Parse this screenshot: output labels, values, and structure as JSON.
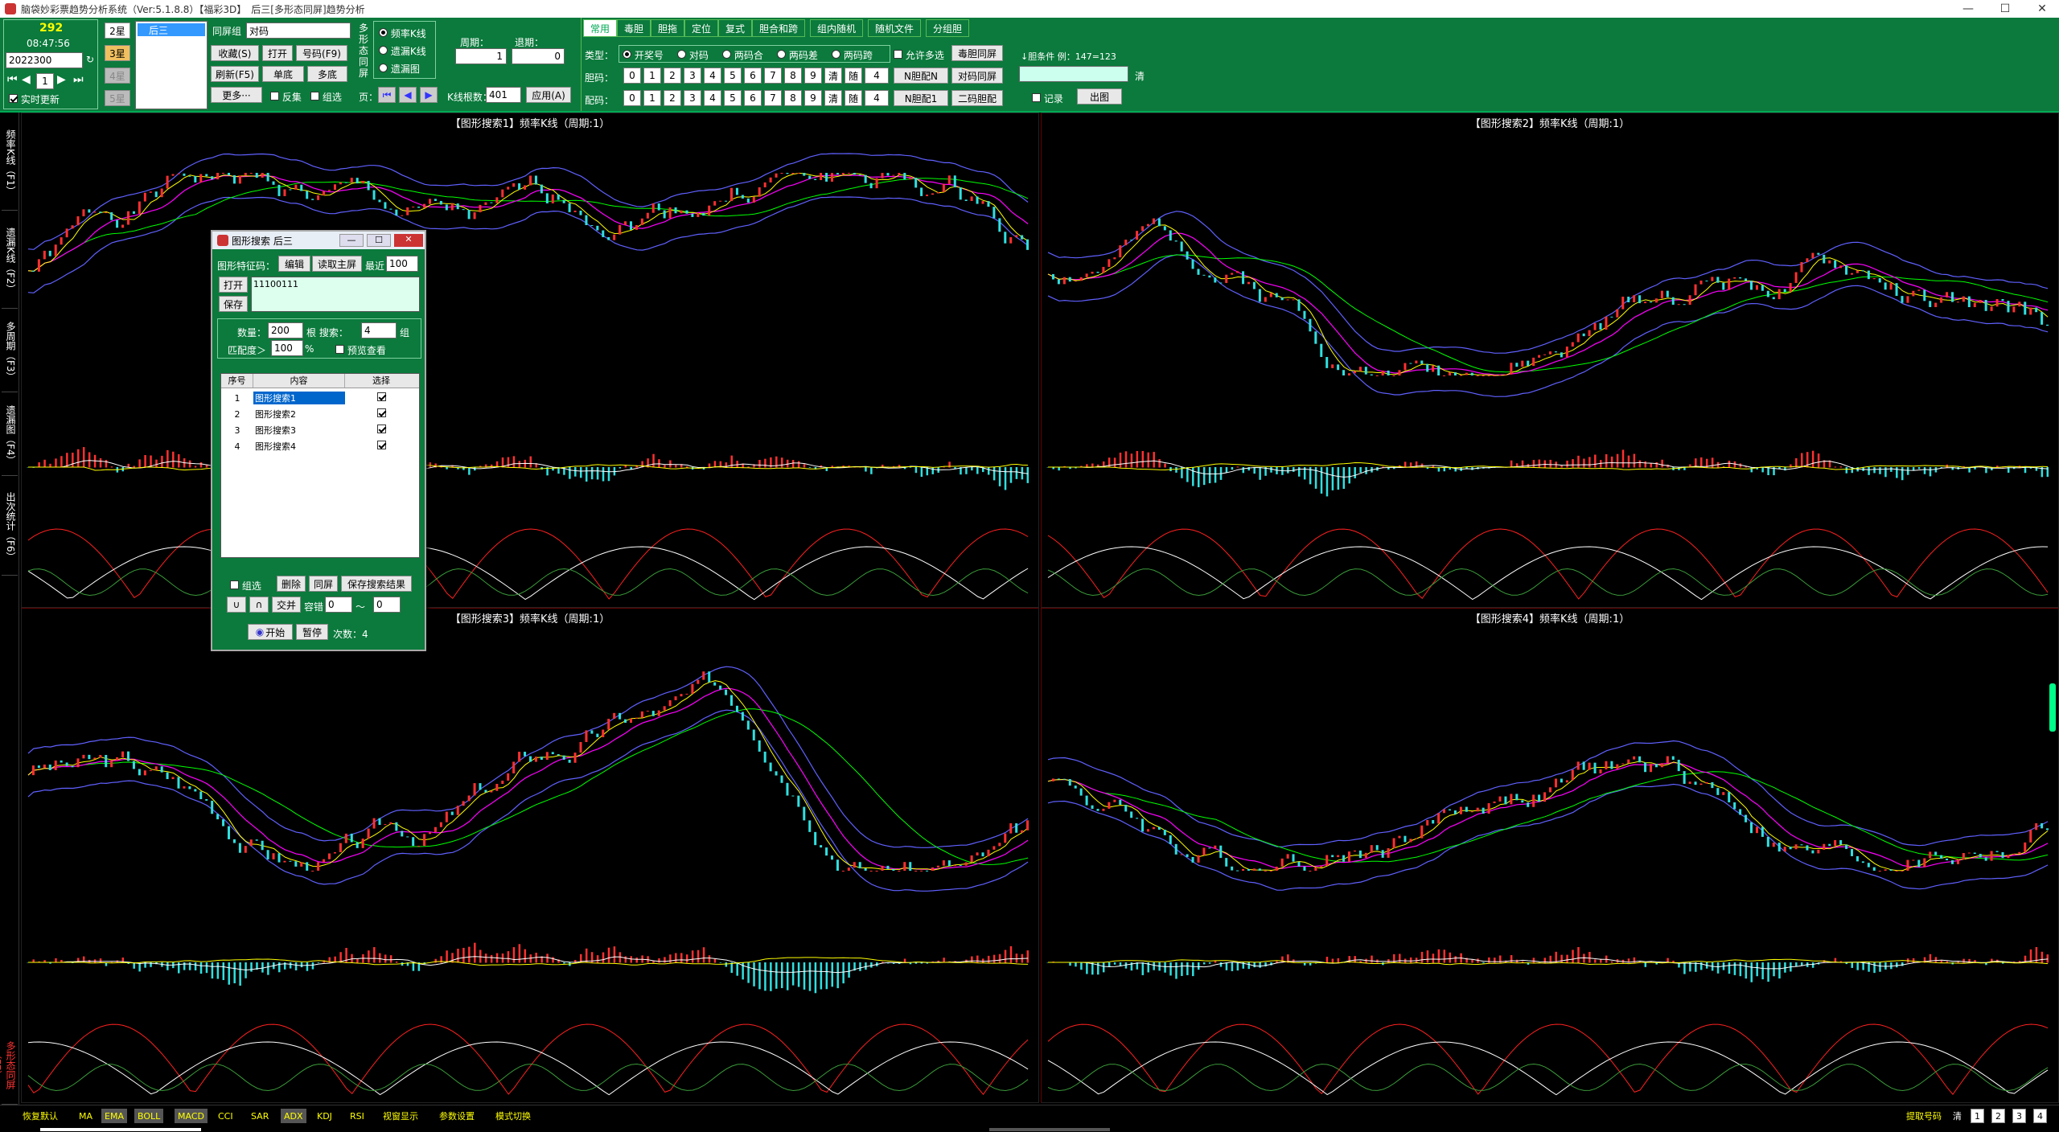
{
  "window": {
    "title": "脑袋妙彩票趋势分析系统（Ver:5.1.8.8）【福彩3D】　后三[多形态同屏]趋势分析",
    "minimize": "—",
    "maximize": "☐",
    "close": "✕"
  },
  "toolbar": {
    "counter": "292",
    "time": "08:47:56",
    "period": "2022300",
    "step": "1",
    "realtime_label": "实时更新",
    "stars": [
      "2星",
      "3星",
      "4星",
      "5星"
    ],
    "list_item": "后三",
    "tongping_label": "同屏组",
    "tongping_value": "对码",
    "buttons_row1": [
      "收藏(S)",
      "打开",
      "号码(F9)"
    ],
    "buttons_row2": [
      "刷新(F5)",
      "单底",
      "多底"
    ],
    "more_label": "更多···",
    "fanji_label": "反集",
    "zuxuan_label": "组选",
    "multi_form_label": "多形态同屏",
    "view_options": [
      "频率K线",
      "遗漏K线",
      "遗漏图"
    ],
    "page_label": "页：",
    "cycle_label": "周期：",
    "cycle_value": "1",
    "back_label": "退期：",
    "back_value": "0",
    "ticks_label": "K线根数：",
    "ticks_value": "401",
    "apply_label": "应用(A)",
    "tabs": [
      "常用",
      "毒胆",
      "胆拖",
      "定位",
      "复式",
      "胆合和跨",
      "组内随机",
      "随机文件",
      "分组胆"
    ],
    "type_label": "类型：",
    "type_options": [
      "开奖号",
      "对码",
      "两码合",
      "两码差",
      "两码跨"
    ],
    "allow_multi_label": "允许多选",
    "du_label": "毒胆同屏",
    "danma_label": "胆码：",
    "peima_label": "配码：",
    "digits": [
      "0",
      "1",
      "2",
      "3",
      "4",
      "5",
      "6",
      "7",
      "8",
      "9"
    ],
    "clear_label": "清",
    "random_label": "随",
    "random_count": "4",
    "n_dan_label": "N胆配N",
    "dui_tongping_label": "对码同屏",
    "n_dan1_label": "N胆配1",
    "erma_label": "二码胆配",
    "condition_label": "↓胆条件 例：147=123",
    "qing_label": "清",
    "record_label": "记录",
    "chutu_label": "出图"
  },
  "sidebar": [
    "频率K线（F1）",
    "遗漏K线（F2）",
    "多周期（F3）",
    "遗漏图（F4）",
    "出次统计（F6）",
    "多形态同屏（F7）"
  ],
  "panels": [
    {
      "title": "【图形搜索1】频率K线（周期:1）"
    },
    {
      "title": "【图形搜索2】频率K线（周期:1）"
    },
    {
      "title": "【图形搜索3】频率K线（周期:1）"
    },
    {
      "title": "【图形搜索4】频率K线（周期:1）"
    }
  ],
  "dialog": {
    "title": "图形搜索 后三",
    "code_label": "图形特征码：",
    "edit_label": "编辑",
    "read_label": "读取主屏",
    "recent_label": "最近",
    "recent_value": "100",
    "open_label": "打开",
    "save_label": "保存",
    "code_value": "11100111",
    "count_label": "数量：",
    "count_value": "200",
    "search_label": "根  搜索：",
    "search_value": "4",
    "unit_label": "组",
    "match_label": "匹配度＞",
    "match_value": "100",
    "pct_label": "%",
    "preview_label": "预览查看",
    "col_index": "序号",
    "col_content": "内容",
    "col_select": "选择",
    "rows": [
      {
        "index": "1",
        "content": "图形搜索1"
      },
      {
        "index": "2",
        "content": "图形搜索2"
      },
      {
        "index": "3",
        "content": "图形搜索3"
      },
      {
        "index": "4",
        "content": "图形搜索4"
      }
    ],
    "zuxuan_label": "组选",
    "delete_label": "删除",
    "tongping_label": "同屏",
    "save_result_label": "保存搜索结果",
    "union_label": "∪",
    "inter_label": "∩",
    "cross_label": "交并",
    "tolerance_label": "容错",
    "tol_a": "0",
    "tilde": "～",
    "tol_b": "0",
    "start_label": "开始",
    "pause_label": "暂停",
    "times_label": "次数：4"
  },
  "statusbar": {
    "items": [
      "恢复默认",
      "MA",
      "EMA",
      "BOLL",
      "MACD",
      "CCI",
      "SAR",
      "ADX",
      "KDJ",
      "RSI",
      "视窗显示",
      "参数设置",
      "模式切换"
    ],
    "right_label": "提取号码",
    "right_qing": "清",
    "pages": [
      "1",
      "2",
      "3",
      "4"
    ]
  },
  "colors": {
    "toolbar_bg": "#0b7a3c",
    "candle_up": "#ff3030",
    "candle_down": "#30e0e0",
    "ma1": "#ffffff",
    "ma2": "#ffff00",
    "ma3": "#ff00ff",
    "ma4": "#00ff00",
    "boll": "#6060ff"
  }
}
